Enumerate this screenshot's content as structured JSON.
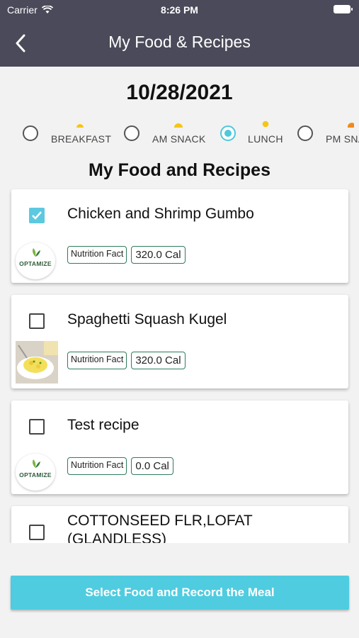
{
  "status_bar": {
    "carrier": "Carrier",
    "time": "8:26 PM"
  },
  "header": {
    "title": "My Food & Recipes"
  },
  "date": "10/28/2021",
  "meals": [
    {
      "label": "BREAKFAST",
      "selected": false
    },
    {
      "label": "AM SNACK",
      "selected": false
    },
    {
      "label": "LUNCH",
      "selected": true
    },
    {
      "label": "PM SNACK",
      "selected": false
    }
  ],
  "section_title": "My Food and Recipes",
  "items": [
    {
      "title": "Chicken and Shrimp Gumbo",
      "checked": true,
      "nutrition_label": "Nutrition Fact",
      "calories": "320.0 Cal",
      "image": "optamize-logo"
    },
    {
      "title": "Spaghetti Squash Kugel",
      "checked": false,
      "nutrition_label": "Nutrition Fact",
      "calories": "320.0 Cal",
      "image": "food-photo"
    },
    {
      "title": "Test recipe",
      "checked": false,
      "nutrition_label": "Nutrition Fact",
      "calories": "0.0 Cal",
      "image": "optamize-logo"
    },
    {
      "title": "COTTONSEED FLR,LOFAT (GLANDLESS)",
      "checked": false
    }
  ],
  "logo_text": "OPTAMIZE",
  "cta_label": "Select Food and Record the Meal",
  "colors": {
    "header_bg": "#4a4a5a",
    "accent": "#4fcce0",
    "badge_border": "#2e7d5b"
  }
}
